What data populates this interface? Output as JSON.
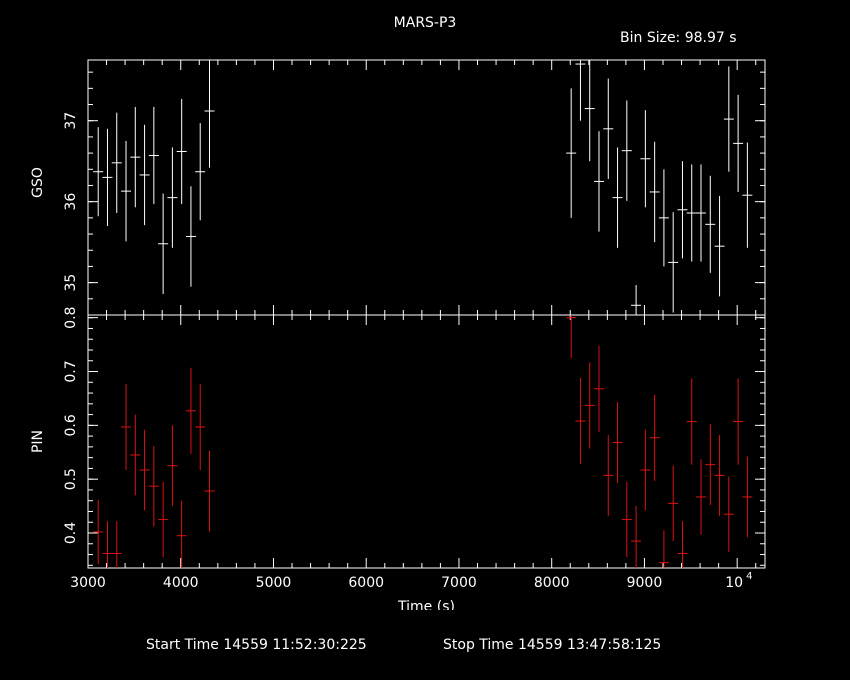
{
  "title": "MARS-P3",
  "bin_label": "Bin Size: 98.97 s",
  "footer": {
    "start": "Start Time 14559 11:52:30:225",
    "stop": "Stop Time 14559 13:47:58:125"
  },
  "colors": {
    "background": "#000000",
    "axes": "#ffffff",
    "gso": "#ffffff",
    "pin": "#dd1111"
  },
  "chart_data": [
    {
      "type": "scatter",
      "name": "GSO",
      "ylabel": "GSO",
      "xlim": [
        3000,
        10300
      ],
      "ylim": [
        34.6,
        37.75
      ],
      "yticks_labeled": [
        35,
        36,
        37
      ],
      "points": [
        {
          "x": 3110,
          "y": 36.37,
          "err": 0.55
        },
        {
          "x": 3210,
          "y": 36.3,
          "err": 0.6
        },
        {
          "x": 3310,
          "y": 36.48,
          "err": 0.62
        },
        {
          "x": 3410,
          "y": 36.13,
          "err": 0.62
        },
        {
          "x": 3510,
          "y": 36.55,
          "err": 0.62
        },
        {
          "x": 3610,
          "y": 36.33,
          "err": 0.62
        },
        {
          "x": 3710,
          "y": 36.57,
          "err": 0.6
        },
        {
          "x": 3810,
          "y": 35.48,
          "err": 0.62
        },
        {
          "x": 3910,
          "y": 36.05,
          "err": 0.62
        },
        {
          "x": 4010,
          "y": 36.62,
          "err": 0.65
        },
        {
          "x": 4110,
          "y": 35.57,
          "err": 0.62
        },
        {
          "x": 4210,
          "y": 36.37,
          "err": 0.6
        },
        {
          "x": 4310,
          "y": 37.12,
          "err": 0.7
        },
        {
          "x": 8210,
          "y": 36.6,
          "err": 0.8
        },
        {
          "x": 8310,
          "y": 37.7,
          "err": 0.7
        },
        {
          "x": 8410,
          "y": 37.15,
          "err": 0.65
        },
        {
          "x": 8510,
          "y": 36.25,
          "err": 0.62
        },
        {
          "x": 8610,
          "y": 36.9,
          "err": 0.62
        },
        {
          "x": 8710,
          "y": 36.05,
          "err": 0.62
        },
        {
          "x": 8810,
          "y": 36.63,
          "err": 0.62
        },
        {
          "x": 8910,
          "y": 34.72,
          "err": 0.25
        },
        {
          "x": 9010,
          "y": 36.53,
          "err": 0.6
        },
        {
          "x": 9110,
          "y": 36.12,
          "err": 0.62
        },
        {
          "x": 9210,
          "y": 35.8,
          "err": 0.6
        },
        {
          "x": 9310,
          "y": 35.25,
          "err": 0.62
        },
        {
          "x": 9410,
          "y": 35.9,
          "err": 0.6
        },
        {
          "x": 9510,
          "y": 35.86,
          "err": 0.6
        },
        {
          "x": 9610,
          "y": 35.86,
          "err": 0.6
        },
        {
          "x": 9710,
          "y": 35.72,
          "err": 0.6
        },
        {
          "x": 9810,
          "y": 35.45,
          "err": 0.62
        },
        {
          "x": 9910,
          "y": 37.02,
          "err": 0.65
        },
        {
          "x": 10010,
          "y": 36.72,
          "err": 0.6
        },
        {
          "x": 10110,
          "y": 36.08,
          "err": 0.65
        }
      ]
    },
    {
      "type": "scatter",
      "name": "PIN",
      "ylabel": "PIN",
      "xlabel": "Time (s)",
      "xlim": [
        3000,
        10300
      ],
      "ylim": [
        0.335,
        0.805
      ],
      "yticks_labeled": [
        0.4,
        0.5,
        0.6,
        0.7,
        0.8
      ],
      "xticks_labeled": [
        {
          "v": 3000,
          "t": "3000"
        },
        {
          "v": 4000,
          "t": "4000"
        },
        {
          "v": 5000,
          "t": "5000"
        },
        {
          "v": 6000,
          "t": "6000"
        },
        {
          "v": 7000,
          "t": "7000"
        },
        {
          "v": 8000,
          "t": "8000"
        },
        {
          "v": 9000,
          "t": "9000"
        },
        {
          "v": 10000,
          "t": "10"
        }
      ],
      "xtick_exponent": "4",
      "points": [
        {
          "x": 3110,
          "y": 0.402,
          "err": 0.06
        },
        {
          "x": 3210,
          "y": 0.362,
          "err": 0.06
        },
        {
          "x": 3310,
          "y": 0.362,
          "err": 0.06
        },
        {
          "x": 3410,
          "y": 0.597,
          "err": 0.08
        },
        {
          "x": 3510,
          "y": 0.545,
          "err": 0.075
        },
        {
          "x": 3610,
          "y": 0.517,
          "err": 0.075
        },
        {
          "x": 3710,
          "y": 0.487,
          "err": 0.075
        },
        {
          "x": 3810,
          "y": 0.425,
          "err": 0.07
        },
        {
          "x": 3910,
          "y": 0.525,
          "err": 0.075
        },
        {
          "x": 4010,
          "y": 0.395,
          "err": 0.065
        },
        {
          "x": 4110,
          "y": 0.627,
          "err": 0.08
        },
        {
          "x": 4210,
          "y": 0.597,
          "err": 0.08
        },
        {
          "x": 4310,
          "y": 0.478,
          "err": 0.075
        },
        {
          "x": 8210,
          "y": 0.8,
          "err": 0.075
        },
        {
          "x": 8310,
          "y": 0.608,
          "err": 0.08
        },
        {
          "x": 8410,
          "y": 0.637,
          "err": 0.08
        },
        {
          "x": 8510,
          "y": 0.668,
          "err": 0.08
        },
        {
          "x": 8610,
          "y": 0.507,
          "err": 0.075
        },
        {
          "x": 8710,
          "y": 0.568,
          "err": 0.075
        },
        {
          "x": 8810,
          "y": 0.425,
          "err": 0.07
        },
        {
          "x": 8910,
          "y": 0.385,
          "err": 0.065
        },
        {
          "x": 9010,
          "y": 0.517,
          "err": 0.075
        },
        {
          "x": 9110,
          "y": 0.577,
          "err": 0.08
        },
        {
          "x": 9210,
          "y": 0.345,
          "err": 0.06
        },
        {
          "x": 9310,
          "y": 0.455,
          "err": 0.07
        },
        {
          "x": 9410,
          "y": 0.362,
          "err": 0.06
        },
        {
          "x": 9510,
          "y": 0.607,
          "err": 0.08
        },
        {
          "x": 9610,
          "y": 0.467,
          "err": 0.07
        },
        {
          "x": 9710,
          "y": 0.527,
          "err": 0.075
        },
        {
          "x": 9810,
          "y": 0.507,
          "err": 0.075
        },
        {
          "x": 9910,
          "y": 0.435,
          "err": 0.07
        },
        {
          "x": 10010,
          "y": 0.607,
          "err": 0.08
        },
        {
          "x": 10110,
          "y": 0.467,
          "err": 0.075
        }
      ]
    }
  ]
}
